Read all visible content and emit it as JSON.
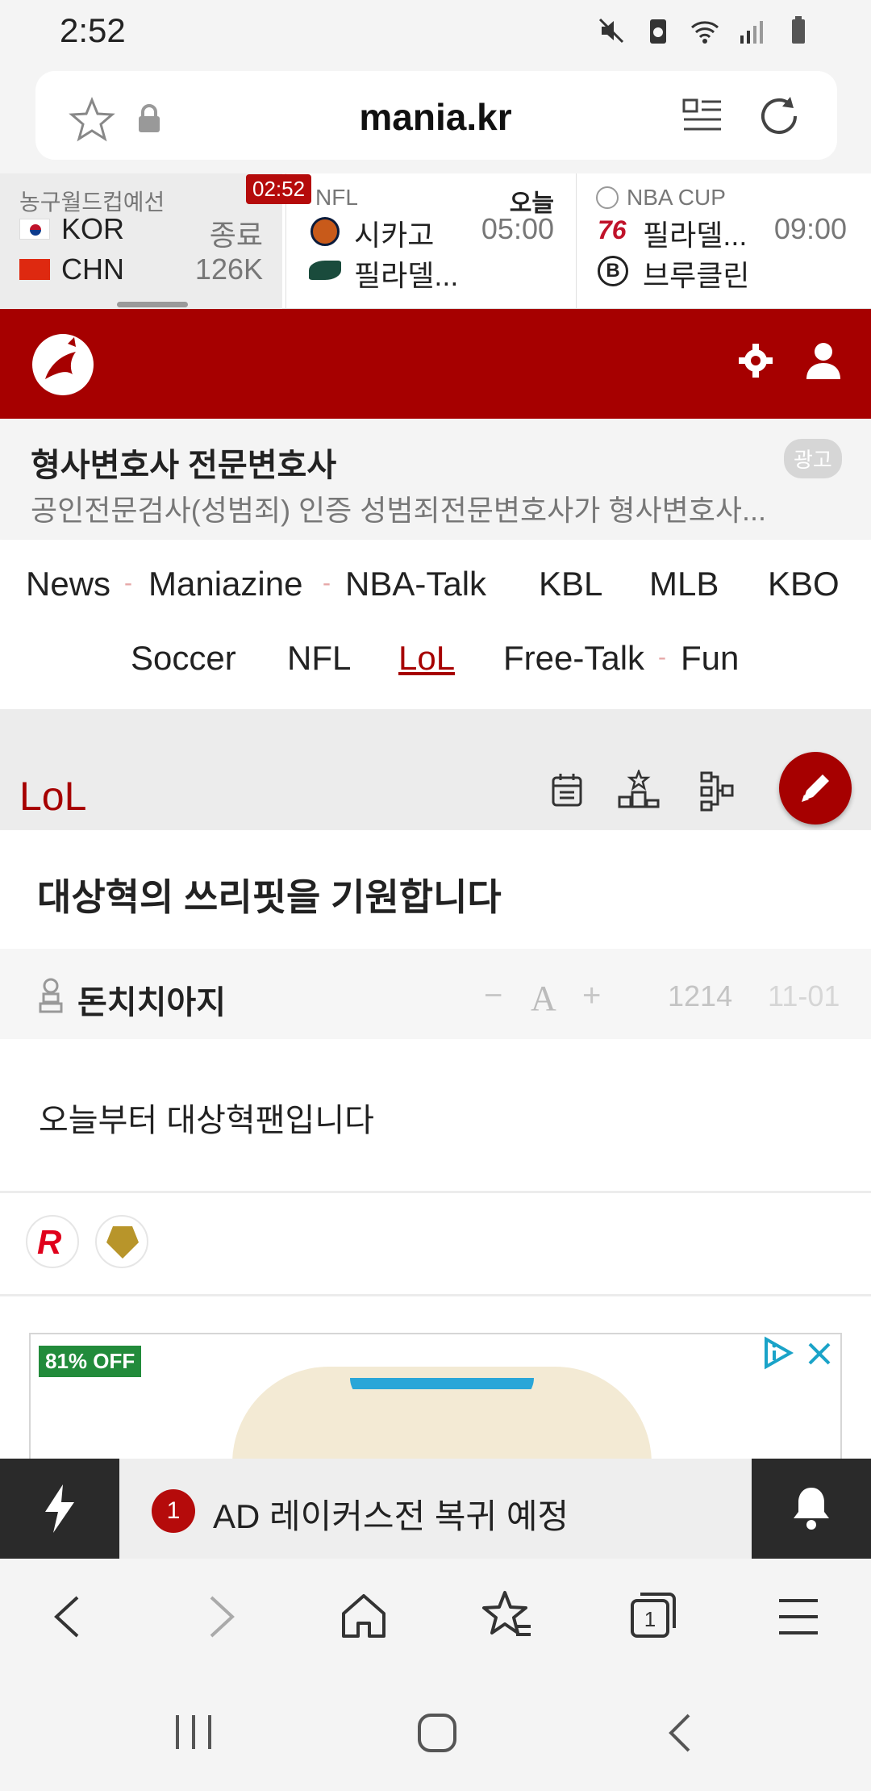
{
  "status": {
    "time": "2:52",
    "icons": [
      "mute-icon",
      "battery-saver-icon",
      "wifi-icon",
      "signal-icon",
      "battery-icon"
    ]
  },
  "browser": {
    "url": "mania.kr",
    "bookmark_icon": "star-icon",
    "lock_icon": "lock-icon",
    "reader_icon": "reader-mode-icon",
    "reload_icon": "reload-icon"
  },
  "scores": {
    "timer": "02:52",
    "games": [
      {
        "league": "농구월드컵예선",
        "team1": "KOR",
        "team2": "CHN",
        "right1": "종료",
        "right2": "126K"
      },
      {
        "league": "NFL",
        "right_header": "오늘",
        "team1": "시카고",
        "team2": "필라델...",
        "right1": "05:00",
        "right2": ""
      },
      {
        "league": "NBA CUP",
        "team1": "필라델...",
        "team2": "브루클린",
        "right1": "09:00",
        "right2": ""
      }
    ]
  },
  "ad": {
    "title": "형사변호사 전문변호사",
    "desc": "공인전문검사(성범죄) 인증 성범죄전문변호사가 형사변호사...",
    "badge": "광고"
  },
  "nav": {
    "row1": [
      "News",
      "Maniazine",
      "NBA-Talk",
      "KBL",
      "MLB",
      "KBO"
    ],
    "row2": [
      "Soccer",
      "NFL",
      "LoL",
      "Free-Talk",
      "Fun"
    ],
    "active": "LoL",
    "dash": "-"
  },
  "board": {
    "title": "LoL"
  },
  "post": {
    "title": "대상혁의 쓰리핏을 기원합니다",
    "author": "돈치치아지",
    "font_minus": "−",
    "font_a": "A",
    "font_plus": "+",
    "views": "1214",
    "date": "11-01",
    "body": "오늘부터 대상혁팬입니다"
  },
  "product_ad": {
    "badge": "81% OFF"
  },
  "newsbar": {
    "number": "1",
    "text": "AD 레이커스전 복귀 예정"
  },
  "colors": {
    "brand_red": "#a60000",
    "badge_red": "#b50b0b",
    "green_badge": "#228b3b"
  }
}
